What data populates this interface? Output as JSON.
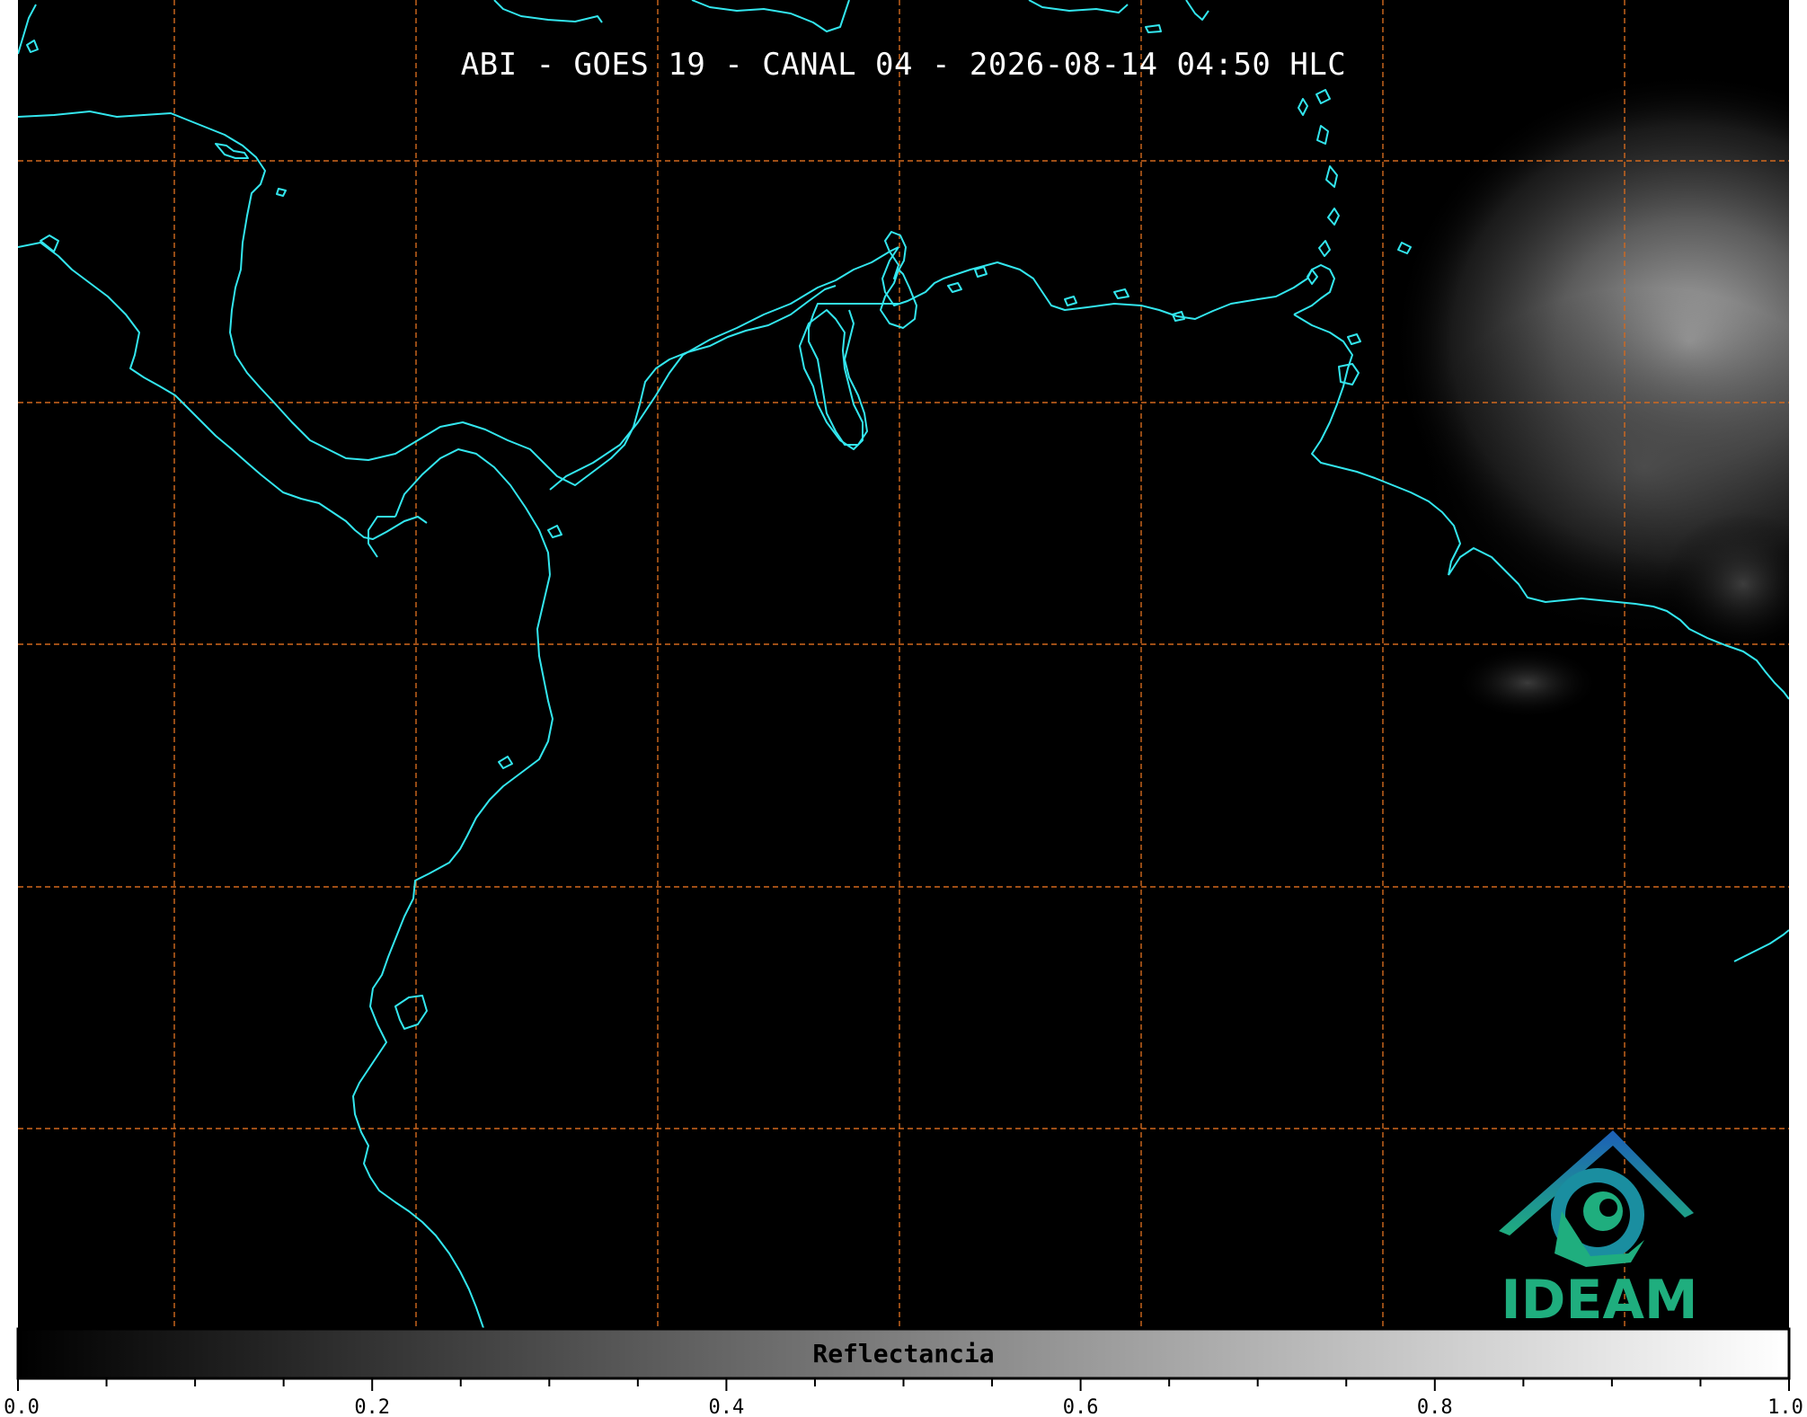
{
  "title": "ABI - GOES 19 - CANAL 04 - 2026-08-14 04:50 HLC",
  "logo": {
    "text": "IDEAM"
  },
  "colorbar": {
    "label": "Reflectancia",
    "range": [
      0.0,
      1.0
    ],
    "major_ticks": [
      "0.0",
      "0.2",
      "0.4",
      "0.6",
      "0.8",
      "1.0"
    ],
    "minor_tick_step": 0.05,
    "colormap": "grayscale"
  },
  "colors": {
    "background": "#000000",
    "coastline": "#33e6ee",
    "gridlines": "#d2691e",
    "title_text": "#ffffff",
    "logo_blue": "#1d6fb8",
    "logo_teal": "#1fae7e"
  },
  "map": {
    "gridlines": "dashed",
    "gridline_color_name": "orange",
    "features": [
      "coastlines",
      "cloud-cover-east"
    ]
  }
}
